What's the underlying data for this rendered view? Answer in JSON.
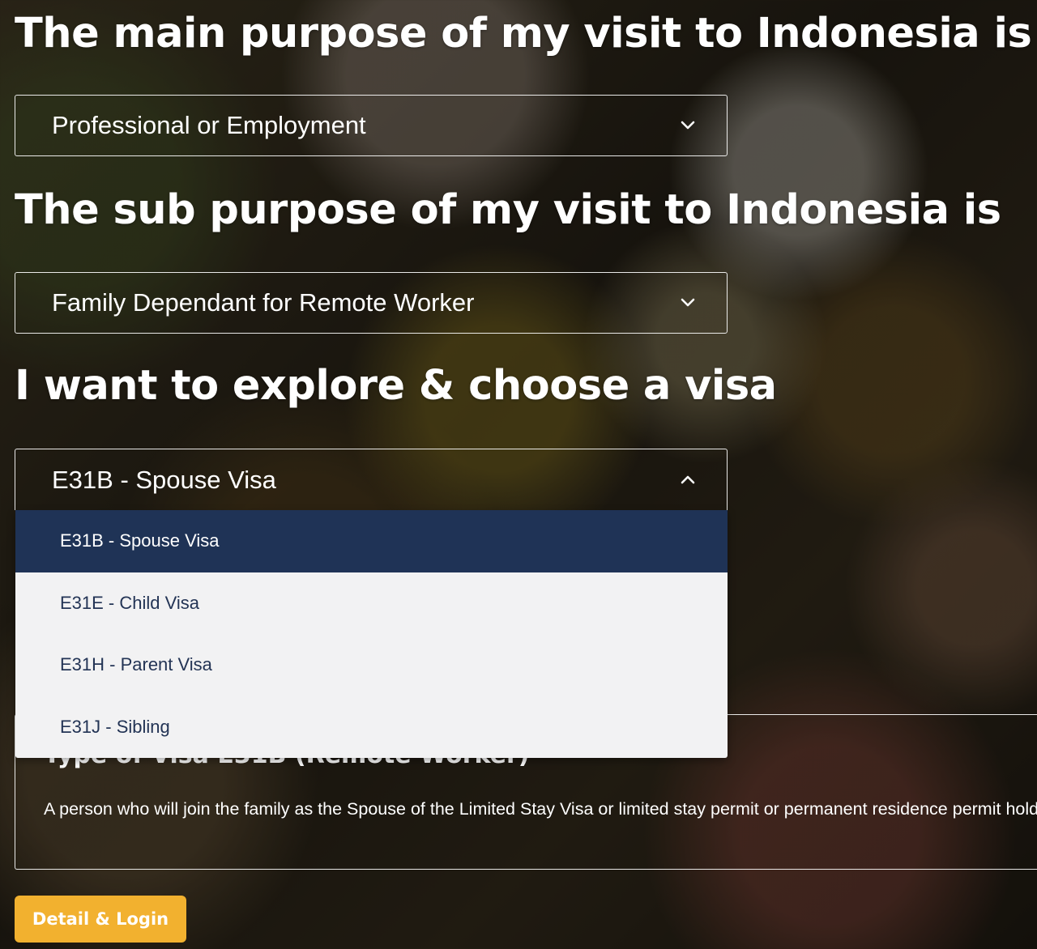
{
  "headings": {
    "main_purpose": "The main purpose of my visit to Indonesia is",
    "sub_purpose": "The sub purpose of my visit to Indonesia is",
    "explore": "I want to explore & choose a visa"
  },
  "selects": {
    "main_purpose": {
      "value": "Professional or Employment",
      "icon": "chevron-down-icon"
    },
    "sub_purpose": {
      "value": "Family Dependant for Remote Worker",
      "icon": "chevron-down-icon"
    },
    "visa": {
      "value": "E31B - Spouse Visa",
      "icon": "chevron-up-icon",
      "expanded": true
    }
  },
  "visa_options": [
    {
      "label": "E31B - Spouse Visa",
      "selected": true
    },
    {
      "label": "E31E - Child Visa",
      "selected": false
    },
    {
      "label": "E31H - Parent Visa",
      "selected": false
    },
    {
      "label": "E31J - Sibling",
      "selected": false
    }
  ],
  "info": {
    "title": "Type of Visa E31B (Remote Worker)",
    "description": "A person who will join the family as the Spouse of the Limited Stay Visa or limited stay permit or permanent residence permit holder"
  },
  "button": {
    "label": "Detail & Login"
  },
  "colors": {
    "selected_option_bg": "#1f3356",
    "option_text": "#233455",
    "dropdown_bg": "#f2f2f3",
    "button_bg": "#f2b12f"
  }
}
